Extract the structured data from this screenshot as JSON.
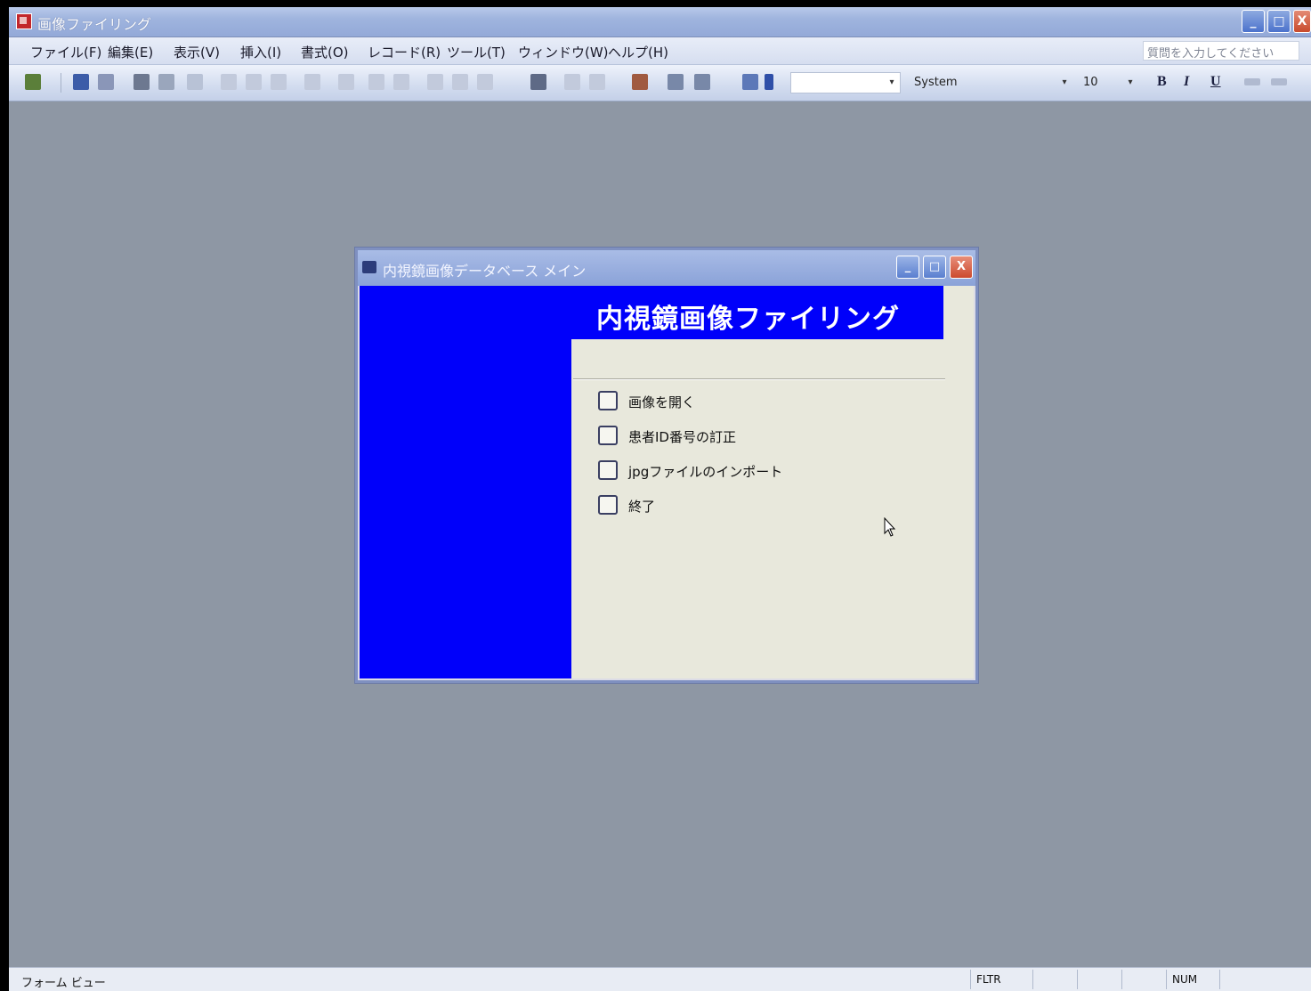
{
  "app": {
    "title": "画像ファイリング",
    "window_buttons": {
      "minimize": "_",
      "maximize": "□",
      "close": "X"
    }
  },
  "menu": {
    "items": [
      "ファイル(F)",
      "編集(E)",
      "表示(V)",
      "挿入(I)",
      "書式(O)",
      "レコード(R)",
      "ツール(T)",
      "ウィンドウ(W)",
      "ヘルプ(H)"
    ],
    "help_placeholder": "質問を入力してください"
  },
  "toolbar": {
    "object_combo": "",
    "font_combo": "System",
    "size_combo": "10",
    "bold": "B",
    "italic": "I",
    "underline": "U"
  },
  "form": {
    "window_title": "内視鏡画像データベース メイン",
    "heading": "内視鏡画像ファイリング",
    "options": [
      "画像を開く",
      "患者ID番号の訂正",
      "jpgファイルのインポート",
      "終了"
    ],
    "window_buttons": {
      "minimize": "_",
      "maximize": "□",
      "close": "X"
    }
  },
  "status": {
    "left": "フォーム ビュー",
    "fltr": "FLTR",
    "num": "NUM"
  },
  "colors": {
    "form_blue": "#0000fa",
    "workspace": "#8e97a4"
  }
}
